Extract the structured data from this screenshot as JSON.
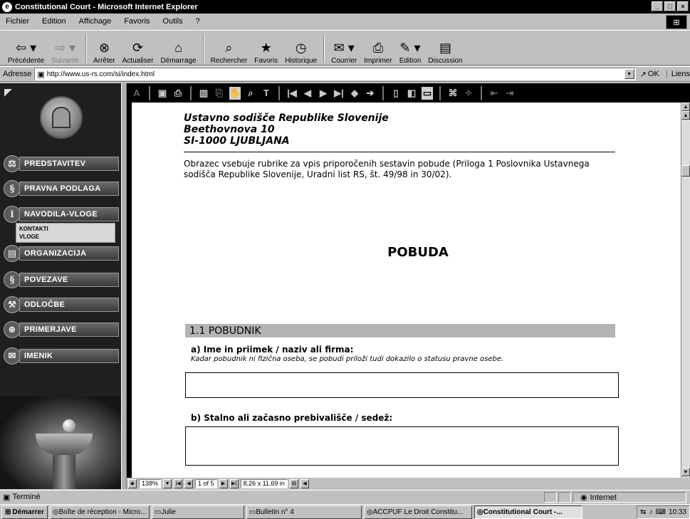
{
  "window": {
    "title": "Constitutional Court - Microsoft Internet Explorer"
  },
  "menu": [
    "Fichier",
    "Edition",
    "Affichage",
    "Favoris",
    "Outils",
    "?"
  ],
  "toolbar": [
    {
      "label": "Précédente",
      "icon": "back-arrow-icon",
      "glyph": "⇦",
      "disabled": false,
      "caret": true
    },
    {
      "label": "Suivante",
      "icon": "forward-arrow-icon",
      "glyph": "⇨",
      "disabled": true,
      "caret": true
    },
    {
      "label": "Arrêter",
      "icon": "stop-icon",
      "glyph": "⊗",
      "disabled": false
    },
    {
      "label": "Actualiser",
      "icon": "refresh-icon",
      "glyph": "⟳",
      "disabled": false
    },
    {
      "label": "Démarrage",
      "icon": "home-icon",
      "glyph": "⌂",
      "disabled": false
    },
    {
      "label": "Rechercher",
      "icon": "search-icon",
      "glyph": "⌕",
      "disabled": false
    },
    {
      "label": "Favoris",
      "icon": "favorites-icon",
      "glyph": "★",
      "disabled": false
    },
    {
      "label": "Historique",
      "icon": "history-icon",
      "glyph": "◷",
      "disabled": false
    },
    {
      "label": "Courrier",
      "icon": "mail-icon",
      "glyph": "✉",
      "disabled": false,
      "caret": true
    },
    {
      "label": "Imprimer",
      "icon": "print-icon",
      "glyph": "⎙",
      "disabled": false
    },
    {
      "label": "Edition",
      "icon": "edit-icon",
      "glyph": "✎",
      "disabled": false,
      "caret": true
    },
    {
      "label": "Discussion",
      "icon": "discussion-icon",
      "glyph": "▤",
      "disabled": false
    }
  ],
  "address": {
    "label": "Adresse",
    "url": "http://www.us-rs.com/si/index.html",
    "go": "OK",
    "links": "Liens"
  },
  "sidebar": {
    "items": [
      {
        "label": "PREDSTAVITEV",
        "icon": "scales-icon",
        "glyph": "⚖"
      },
      {
        "label": "PRAVNA PODLAGA",
        "icon": "section-sign-icon",
        "glyph": "§"
      },
      {
        "label": "NAVODILA-VLOGE",
        "icon": "info-icon",
        "glyph": "i"
      },
      {
        "label": "ORGANIZACIJA",
        "icon": "document-icon",
        "glyph": "▤"
      },
      {
        "label": "POVEZAVE",
        "icon": "links-icon",
        "glyph": "§"
      },
      {
        "label": "ODLOČBE",
        "icon": "gavel-icon",
        "glyph": "⚒"
      },
      {
        "label": "PRIMERJAVE",
        "icon": "globe-icon",
        "glyph": "⊕"
      },
      {
        "label": "IMENIK",
        "icon": "envelope-icon",
        "glyph": "✉"
      }
    ],
    "submenu": [
      "KONTAKTI",
      "VLOGE"
    ]
  },
  "document": {
    "court_line1": "Ustavno sodišče Republike Slovenije",
    "court_line2": "Beethovnova 10",
    "court_line3": "SI-1000 LJUBLJANA",
    "intro": "Obrazec vsebuje rubrike za vpis priporočenih sestavin pobude (Priloga 1 Poslovnika Ustavnega sodišča Republike Slovenije, Uradni list RS, št. 49/98 in 30/02).",
    "heading": "POBUDA",
    "section_title": "1.1  POBUDNIK",
    "field_a_label": "a) Ime in priimek / naziv ali firma:",
    "field_a_note": "Kadar pobudnik ni fizična oseba, se pobudi priloži tudi dokazilo o statusu pravne osebe.",
    "field_b_label": "b) Stalno ali začasno prebivališče / sedež:"
  },
  "viewer": {
    "zoom": "138%",
    "page": "1 of 5",
    "size": "8,26 x 11,69 in"
  },
  "status": {
    "text": "Terminé",
    "zone": "Internet"
  },
  "taskbar": {
    "start": "Démarrer",
    "tasks": [
      {
        "label": "Boîte de réception - Micro...",
        "icon": "outlook-icon",
        "active": false,
        "width": 140
      },
      {
        "label": "Julie",
        "icon": "folder-icon",
        "active": false,
        "width": 130
      },
      {
        "label": "Bulletin n° 4",
        "icon": "folder-icon",
        "active": false,
        "width": 162
      },
      {
        "label": "ACCPUF Le Droit Constitu...",
        "icon": "ie-icon",
        "active": false,
        "width": 152
      },
      {
        "label": "Constitutional Court -...",
        "icon": "ie-icon",
        "active": true,
        "width": 152
      }
    ],
    "clock": "10:33"
  }
}
